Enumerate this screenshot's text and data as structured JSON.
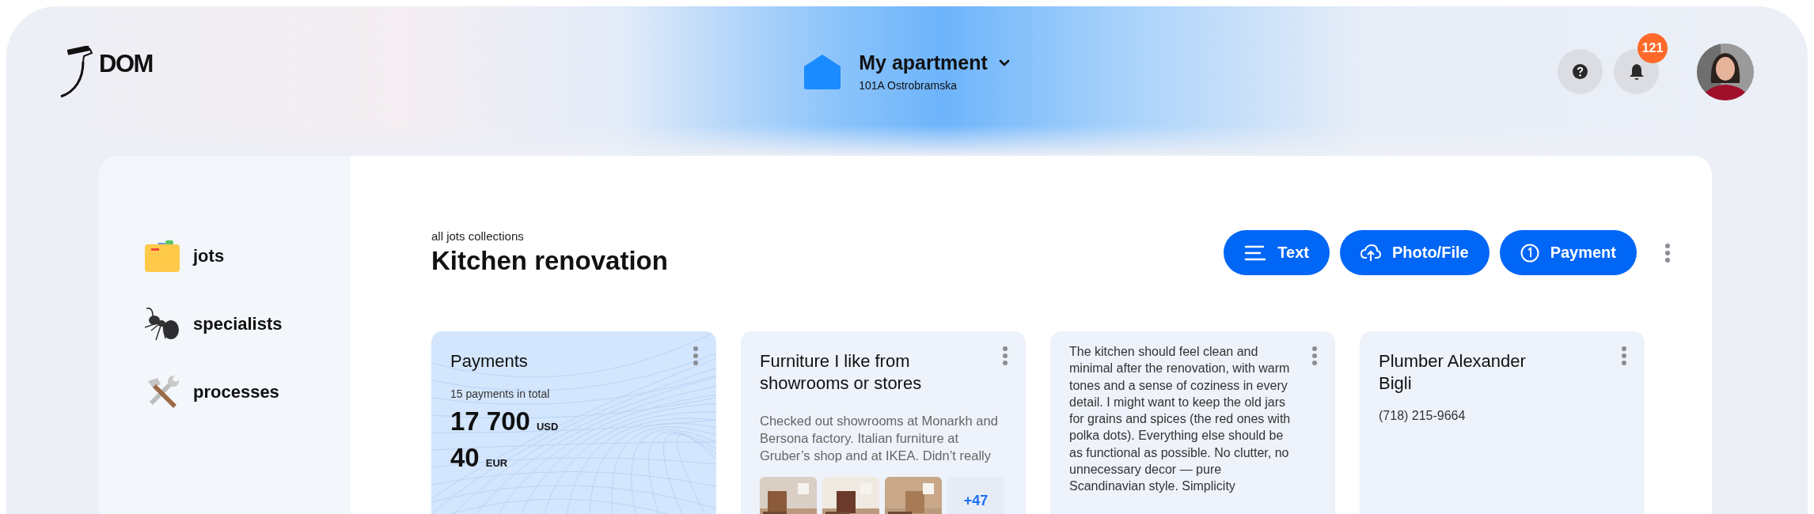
{
  "header": {
    "logo": "DOM",
    "location": {
      "title": "My apartment",
      "address": "101A Ostrobramska"
    },
    "notifications": {
      "count": "121"
    }
  },
  "sidebar": {
    "items": [
      {
        "label": "jots",
        "kind": "folder"
      },
      {
        "label": "specialists",
        "kind": "ant"
      },
      {
        "label": "processes",
        "kind": "tools"
      }
    ]
  },
  "collection": {
    "breadcrumb": "all jots collections",
    "title": "Kitchen renovation"
  },
  "actions": [
    {
      "label": "Text",
      "kind": "text"
    },
    {
      "label": "Photo/File",
      "kind": "upload"
    },
    {
      "label": "Payment",
      "kind": "payment"
    }
  ],
  "cards": [
    {
      "kind": "payments",
      "title": "Payments",
      "subtitle": "15 payments in total",
      "amounts": [
        {
          "value": "17 700",
          "currency": "USD"
        },
        {
          "value": "40",
          "currency": "EUR"
        }
      ]
    },
    {
      "kind": "note",
      "title": "Furniture I like from showrooms or stores",
      "text": "Checked out showrooms at Monarkh and Bersona factory. Italian furniture at Gruber’s shop and at IKEA. Didn’t really",
      "more": "+47"
    },
    {
      "kind": "text",
      "text": "The kitchen should feel clean and minimal after the renovation, with warm tones and a sense of coziness in every detail. I might want to keep the old jars for grains and spices (the red ones with polka dots). Everything else should be as functional as possible. No clutter, no unnecessary decor — pure Scandinavian style. Simplicity"
    },
    {
      "kind": "contact",
      "title": "Plumber Alexander Bigli",
      "phone": "(718) 215-9664"
    }
  ]
}
